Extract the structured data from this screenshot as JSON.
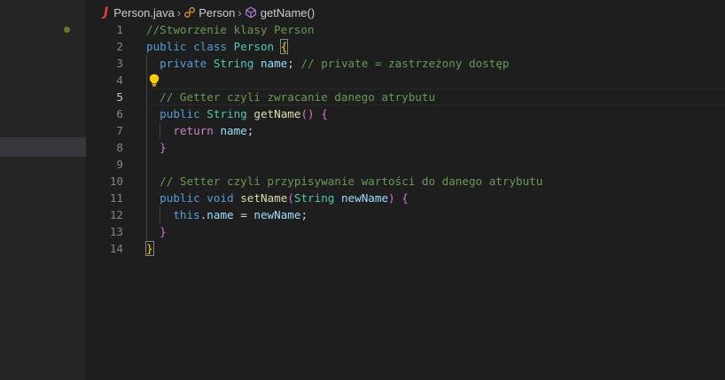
{
  "breadcrumb": {
    "file_icon": "J",
    "file": "Person.java",
    "class_name": "Person",
    "method_name": "getName()"
  },
  "editor": {
    "line_numbers": [
      "1",
      "2",
      "3",
      "4",
      "5",
      "6",
      "7",
      "8",
      "9",
      "10",
      "11",
      "12",
      "13",
      "14"
    ],
    "lines": [
      [
        {
          "t": "//Stworzenie klasy Person",
          "c": "cm"
        }
      ],
      [
        {
          "t": "public",
          "c": "kw"
        },
        {
          "t": " "
        },
        {
          "t": "class",
          "c": "kw"
        },
        {
          "t": " "
        },
        {
          "t": "Person",
          "c": "ty"
        },
        {
          "t": " "
        },
        {
          "t": "{",
          "c": "b1 bmatch"
        }
      ],
      [
        {
          "t": "  "
        },
        {
          "t": "private",
          "c": "kw"
        },
        {
          "t": " "
        },
        {
          "t": "String",
          "c": "ty"
        },
        {
          "t": " "
        },
        {
          "t": "name",
          "c": "va"
        },
        {
          "t": "; "
        },
        {
          "t": "// private = zastrzeżony dostęp",
          "c": "cm"
        }
      ],
      [],
      [
        {
          "t": "  "
        },
        {
          "t": "// Getter czyli zwracanie danego atrybutu",
          "c": "cm"
        }
      ],
      [
        {
          "t": "  "
        },
        {
          "t": "public",
          "c": "kw"
        },
        {
          "t": " "
        },
        {
          "t": "String",
          "c": "ty"
        },
        {
          "t": " "
        },
        {
          "t": "getName",
          "c": "fn"
        },
        {
          "t": "()",
          "c": "b2"
        },
        {
          "t": " "
        },
        {
          "t": "{",
          "c": "b2"
        }
      ],
      [
        {
          "t": "    "
        },
        {
          "t": "return",
          "c": "ctl"
        },
        {
          "t": " "
        },
        {
          "t": "name",
          "c": "va"
        },
        {
          "t": ";"
        }
      ],
      [
        {
          "t": "  "
        },
        {
          "t": "}",
          "c": "b2"
        }
      ],
      [],
      [
        {
          "t": "  "
        },
        {
          "t": "// Setter czyli przypisywanie wartości do danego atrybutu",
          "c": "cm"
        }
      ],
      [
        {
          "t": "  "
        },
        {
          "t": "public",
          "c": "kw"
        },
        {
          "t": " "
        },
        {
          "t": "void",
          "c": "kw"
        },
        {
          "t": " "
        },
        {
          "t": "setName",
          "c": "fn"
        },
        {
          "t": "(",
          "c": "b2"
        },
        {
          "t": "String",
          "c": "ty"
        },
        {
          "t": " "
        },
        {
          "t": "newName",
          "c": "va"
        },
        {
          "t": ")",
          "c": "b2"
        },
        {
          "t": " "
        },
        {
          "t": "{",
          "c": "b2"
        }
      ],
      [
        {
          "t": "    "
        },
        {
          "t": "this",
          "c": "kw"
        },
        {
          "t": "."
        },
        {
          "t": "name",
          "c": "va"
        },
        {
          "t": " = "
        },
        {
          "t": "newName",
          "c": "va"
        },
        {
          "t": ";"
        }
      ],
      [
        {
          "t": "  "
        },
        {
          "t": "}",
          "c": "b2"
        }
      ],
      [
        {
          "t": "}",
          "c": "b1 bmatch"
        }
      ]
    ],
    "active_line": 5,
    "lightbulb_line": 4
  },
  "colors": {
    "background": "#1e1e1e",
    "sidebar": "#252526",
    "keyword": "#569cd6",
    "type": "#4ec9b0",
    "variable": "#9cdcfe",
    "function": "#dcdcaa",
    "comment": "#6a9955",
    "control": "#c586c0",
    "bracket_level1": "#ffd700",
    "bracket_level2": "#da70d6"
  },
  "icons": {
    "file": "java-file-icon",
    "class": "class-icon",
    "method": "method-icon",
    "lightbulb": "lightbulb-icon",
    "separator": "chevron-right-icon"
  }
}
